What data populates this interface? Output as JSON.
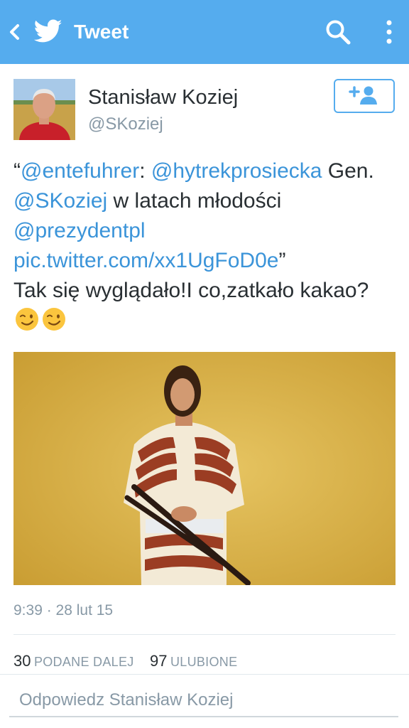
{
  "header": {
    "title": "Tweet",
    "background": "#55acee",
    "icons": [
      "back-icon",
      "twitter-bird-icon",
      "search-icon",
      "more-vert-icon"
    ]
  },
  "tweet": {
    "author_name": "Stanisław Koziej",
    "author_handle": "@SKoziej",
    "follow_icon": "add-user-icon",
    "text": {
      "q_open": "“",
      "m1": "@entefuhrer",
      "sep1": ": ",
      "m2": "@hytrekprosiecka",
      "t1": " Gen. ",
      "m3": "@SKoziej",
      "t2": " w latach młodości ",
      "m4": "@prezydentpl",
      "sp": " ",
      "url": "pic.twitter.com/xx1UgFoD0e",
      "q_close": "”",
      "line2": "Tak się wyglądało!I co,zatkało kakao?",
      "emojis": [
        "winking-face-emoji",
        "winking-face-emoji"
      ]
    },
    "link_color": "#3b94d9",
    "timestamp": "9:39 · 28 lut 15",
    "stats": {
      "retweets_count": "30",
      "retweets_label": "PODANE DALEJ",
      "favorites_count": "97",
      "favorites_label": "ULUBIONE"
    }
  },
  "reply": {
    "placeholder": "Odpowiedz Stanisław Koziej"
  }
}
